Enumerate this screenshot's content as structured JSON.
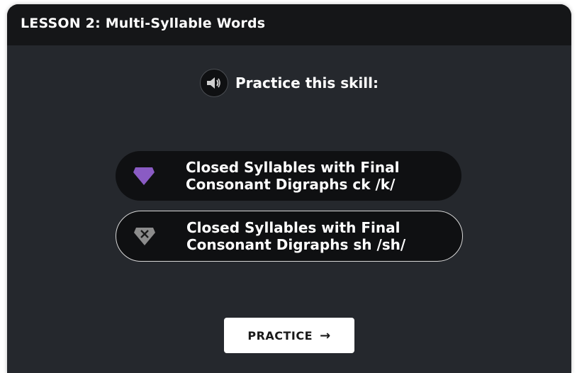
{
  "header": {
    "title": "LESSON 2:  Multi-Syllable Words"
  },
  "prompt": {
    "text": "Practice this skill:",
    "icon": "speaker-icon"
  },
  "skills": [
    {
      "line1": "Closed Syllables with Final",
      "line2": "Consonant Digraphs ck /k/",
      "icon": "gem-icon",
      "icon_color": "#8a5bc4",
      "selected": false
    },
    {
      "line1": "Closed Syllables with Final",
      "line2": "Consonant Digraphs sh /sh/",
      "icon": "gem-x-icon",
      "icon_color": "#8c8c8c",
      "selected": true
    }
  ],
  "practice_button": {
    "label": "PRACTICE",
    "arrow": "→"
  },
  "colors": {
    "card_bg": "#25282d",
    "header_bg": "#151618",
    "pill_bg": "#0f1012",
    "accent": "#8a5bc4"
  }
}
